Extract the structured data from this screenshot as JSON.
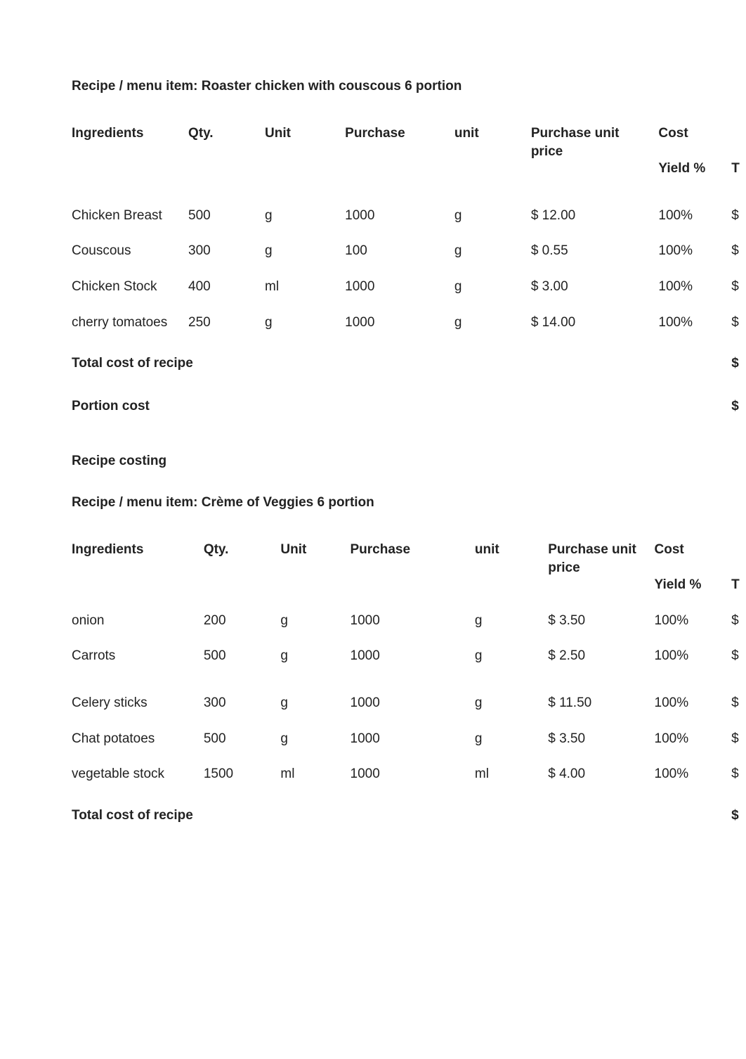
{
  "recipe1": {
    "title": "Recipe / menu item: Roaster chicken with couscous 6 portion",
    "headers": {
      "ingredients": "Ingredients",
      "qty": "Qty.",
      "unit": "Unit",
      "purchase": "Purchase",
      "punit": "unit",
      "pup": "Purchase unit price",
      "cost": "Cost",
      "yield": "Yield %",
      "trail": "T"
    },
    "rows": [
      {
        "ing": "Chicken Breast",
        "qty": "500",
        "unit": "g",
        "purchase": "1000",
        "punit": "g",
        "price": "$ 12.00",
        "yield": "100%",
        "trail": "$"
      },
      {
        "ing": "Couscous",
        "qty": "300",
        "unit": "g",
        "purchase": "100",
        "punit": "g",
        "price": "$ 0.55",
        "yield": "100%",
        "trail": "$"
      },
      {
        "ing": "Chicken Stock",
        "qty": "400",
        "unit": "ml",
        "purchase": "1000",
        "punit": "g",
        "price": "$ 3.00",
        "yield": "100%",
        "trail": "$"
      },
      {
        "ing": "cherry tomatoes",
        "qty": "250",
        "unit": "g",
        "purchase": "1000",
        "punit": "g",
        "price": "$ 14.00",
        "yield": "100%",
        "trail": "$"
      }
    ],
    "total_label": "Total cost of recipe",
    "total_trail": "$",
    "portion_label": "Portion cost",
    "portion_trail": "$"
  },
  "section_heading": "Recipe costing",
  "recipe2": {
    "title": "Recipe / menu item: Crème of Veggies 6 portion",
    "headers": {
      "ingredients": "Ingredients",
      "qty": "Qty.",
      "unit": "Unit",
      "purchase": "Purchase",
      "punit": "unit",
      "pup": "Purchase unit price",
      "cost": "Cost",
      "yield": "Yield %",
      "trail": "T"
    },
    "rows": [
      {
        "ing": "onion",
        "qty": "200",
        "unit": "g",
        "purchase": "1000",
        "punit": "g",
        "price": "$ 3.50",
        "yield": "100%",
        "trail": "$"
      },
      {
        "ing": "Carrots",
        "qty": "500",
        "unit": "g",
        "purchase": "1000",
        "punit": "g",
        "price": "$ 2.50",
        "yield": "100%",
        "trail": "$"
      },
      {
        "ing": "Celery sticks",
        "qty": "300",
        "unit": "g",
        "purchase": "1000",
        "punit": "g",
        "price": "$ 11.50",
        "yield": "100%",
        "trail": "$"
      },
      {
        "ing": "Chat potatoes",
        "qty": "500",
        "unit": "g",
        "purchase": "1000",
        "punit": "g",
        "price": "$ 3.50",
        "yield": "100%",
        "trail": "$"
      },
      {
        "ing": "vegetable stock",
        "qty": "1500",
        "unit": "ml",
        "purchase": "1000",
        "punit": "ml",
        "price": "$ 4.00",
        "yield": "100%",
        "trail": "$"
      }
    ],
    "total_label": "Total cost of recipe",
    "total_trail": "$"
  }
}
